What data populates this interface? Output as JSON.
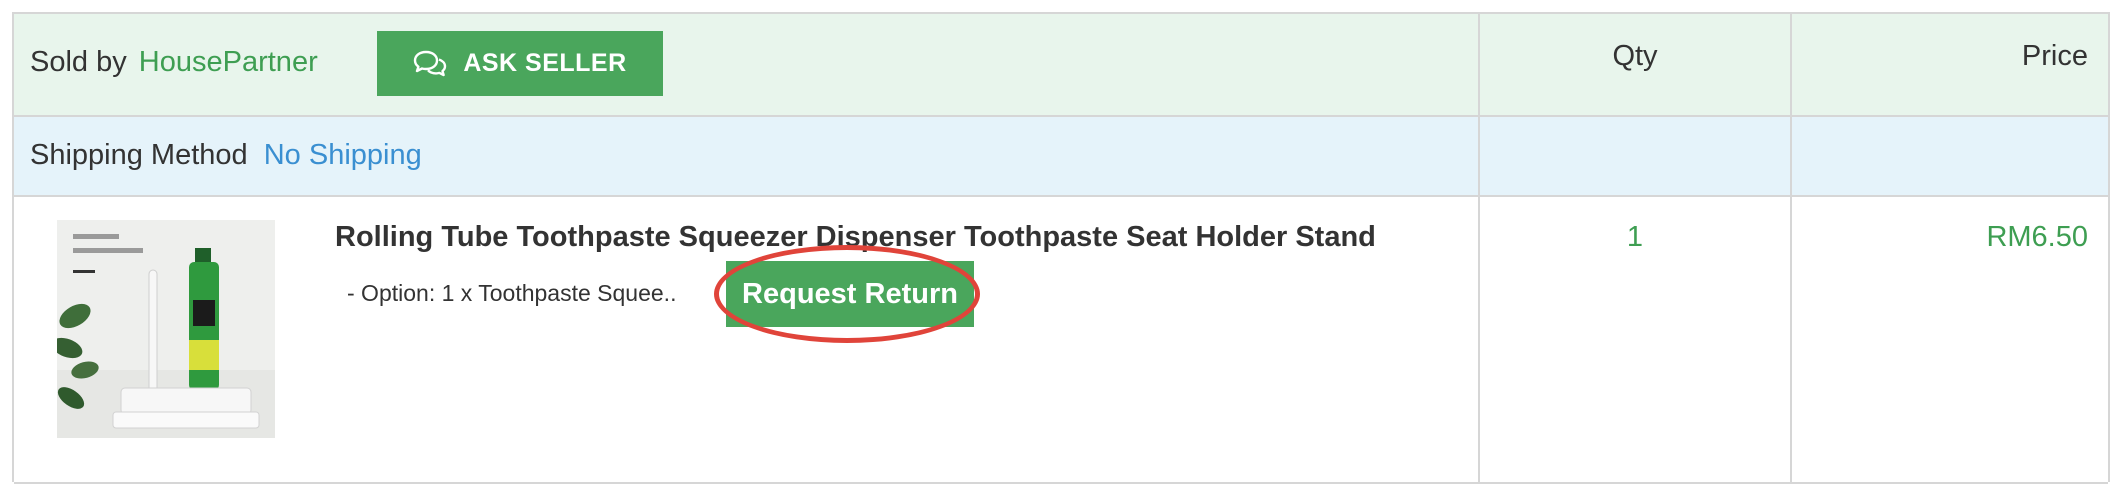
{
  "header": {
    "sold_by_label": "Sold by",
    "seller_name": "HousePartner",
    "ask_seller_label": "ASK SELLER",
    "qty_label": "Qty",
    "price_label": "Price"
  },
  "shipping": {
    "label": "Shipping Method",
    "value": "No Shipping"
  },
  "item": {
    "image_icon": "toothpaste-squeezer-product-image",
    "title": "Rolling Tube Toothpaste Squeezer Dispenser Toothpaste Seat Holder Stand",
    "option": "- Option: 1 x Toothpaste Squee..",
    "request_return_label": "Request Return",
    "qty": "1",
    "price": "RM6.50"
  },
  "colors": {
    "accent_green": "#4aa65c",
    "link_blue": "#3a8fd1",
    "highlight_red": "#e0443a",
    "header_bg": "#e8f5ec",
    "shipping_bg": "#e5f3fa"
  }
}
